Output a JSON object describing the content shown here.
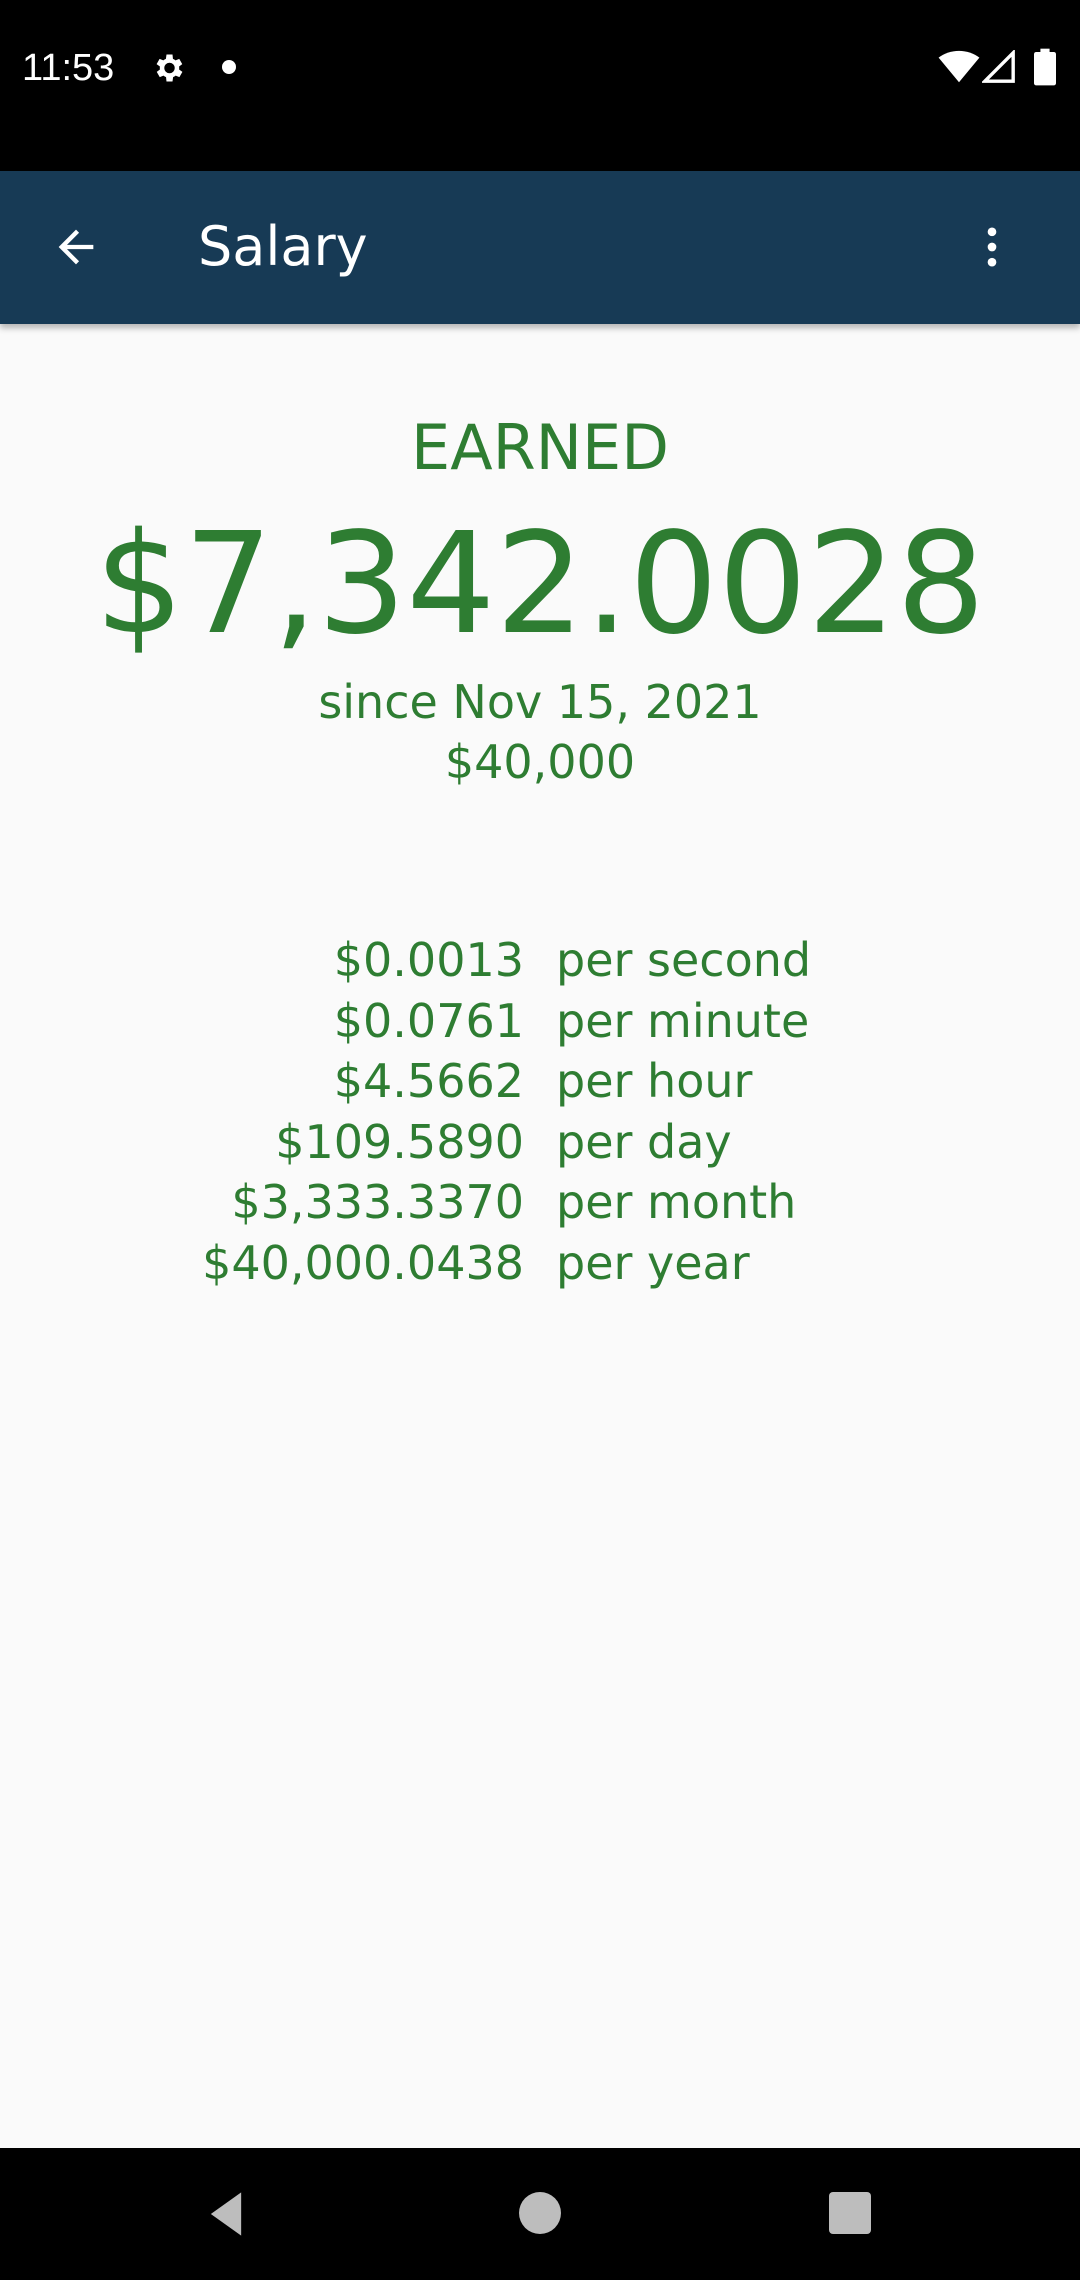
{
  "status_bar": {
    "time": "11:53",
    "icons": [
      "settings-gear-icon",
      "notification-dot-icon",
      "wifi-icon",
      "cell-signal-icon",
      "battery-icon"
    ]
  },
  "app_bar": {
    "title": "Salary",
    "back_icon": "arrow-back-icon",
    "menu_icon": "more-vert-icon",
    "background": "#173a55"
  },
  "summary": {
    "label": "EARNED",
    "amount": "$7,342.0028",
    "since": "since Nov 15, 2021",
    "salary": "$40,000"
  },
  "rates": [
    {
      "value": "$0.0013",
      "unit": "per second"
    },
    {
      "value": "$0.0761",
      "unit": "per minute"
    },
    {
      "value": "$4.5662",
      "unit": "per hour"
    },
    {
      "value": "$109.5890",
      "unit": "per day"
    },
    {
      "value": "$3,333.3370",
      "unit": "per month"
    },
    {
      "value": "$40,000.0438",
      "unit": "per year"
    }
  ],
  "nav_bar": {
    "icons": [
      "nav-back-icon",
      "nav-home-icon",
      "nav-recents-icon"
    ]
  },
  "colors": {
    "accent": "#2e7d32",
    "app_bar": "#173a55",
    "background": "#fafafa"
  }
}
